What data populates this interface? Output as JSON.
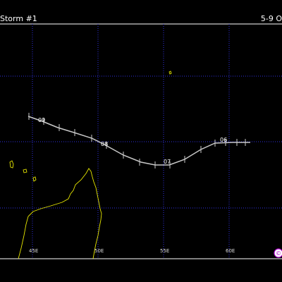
{
  "header": {
    "title": "Storm #1",
    "date_range": "5-9 O"
  },
  "colors": {
    "background": "#000000",
    "grid": "#2f2fe0",
    "coast": "#e6e600",
    "track": "#c8c8c8",
    "frame": "#ffffff",
    "logo": "#b000d0"
  },
  "map": {
    "longitude_labels": [
      "45E",
      "50E",
      "55E",
      "60E"
    ],
    "day_labels": [
      "09",
      "08",
      "07",
      "06"
    ]
  },
  "logo": {
    "icon": "copyright-logo-icon",
    "glyph": "©"
  }
}
